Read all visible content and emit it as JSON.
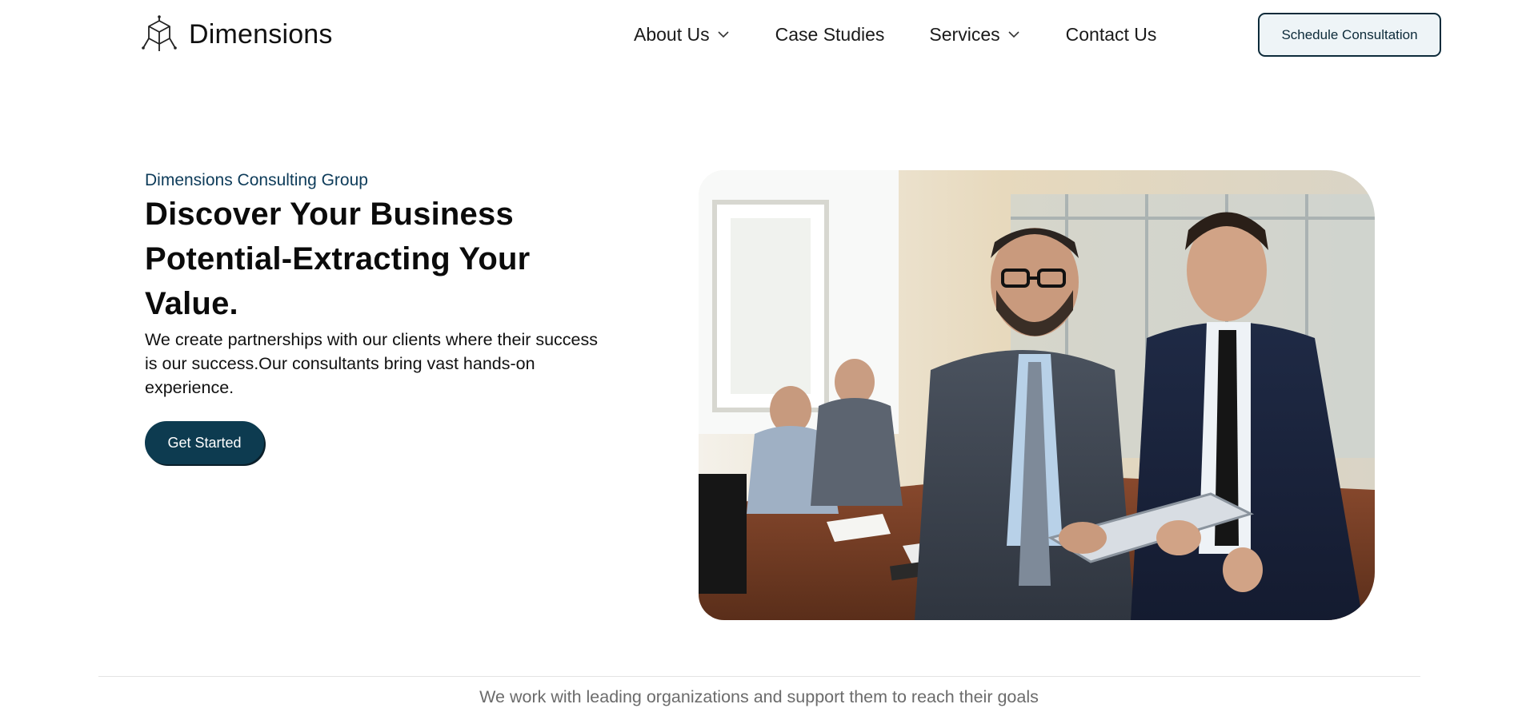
{
  "header": {
    "brand_name": "Dimensions",
    "logo_icon": "cube-network-icon",
    "nav": [
      {
        "label": "About Us",
        "has_dropdown": true
      },
      {
        "label": "Case Studies",
        "has_dropdown": false
      },
      {
        "label": "Services",
        "has_dropdown": true
      },
      {
        "label": "Contact Us",
        "has_dropdown": false
      }
    ],
    "cta_label": "Schedule Consultation"
  },
  "hero": {
    "eyebrow": "Dimensions Consulting Group",
    "headline": "Discover Your Business Potential-Extracting Your Value.",
    "lede": "We create partnerships with our clients where their success is our success.Our consultants bring vast hands-on experience.",
    "button_label": "Get Started",
    "image_icon": "business-meeting-photo"
  },
  "footer_strip": {
    "tagline": "We work with leading organizations and support them to reach their goals"
  },
  "colors": {
    "brand_dark": "#0d3b50",
    "accent_text": "#0d3b59",
    "cta_bg": "#eef4f7",
    "muted_text": "#6b6b6b"
  }
}
